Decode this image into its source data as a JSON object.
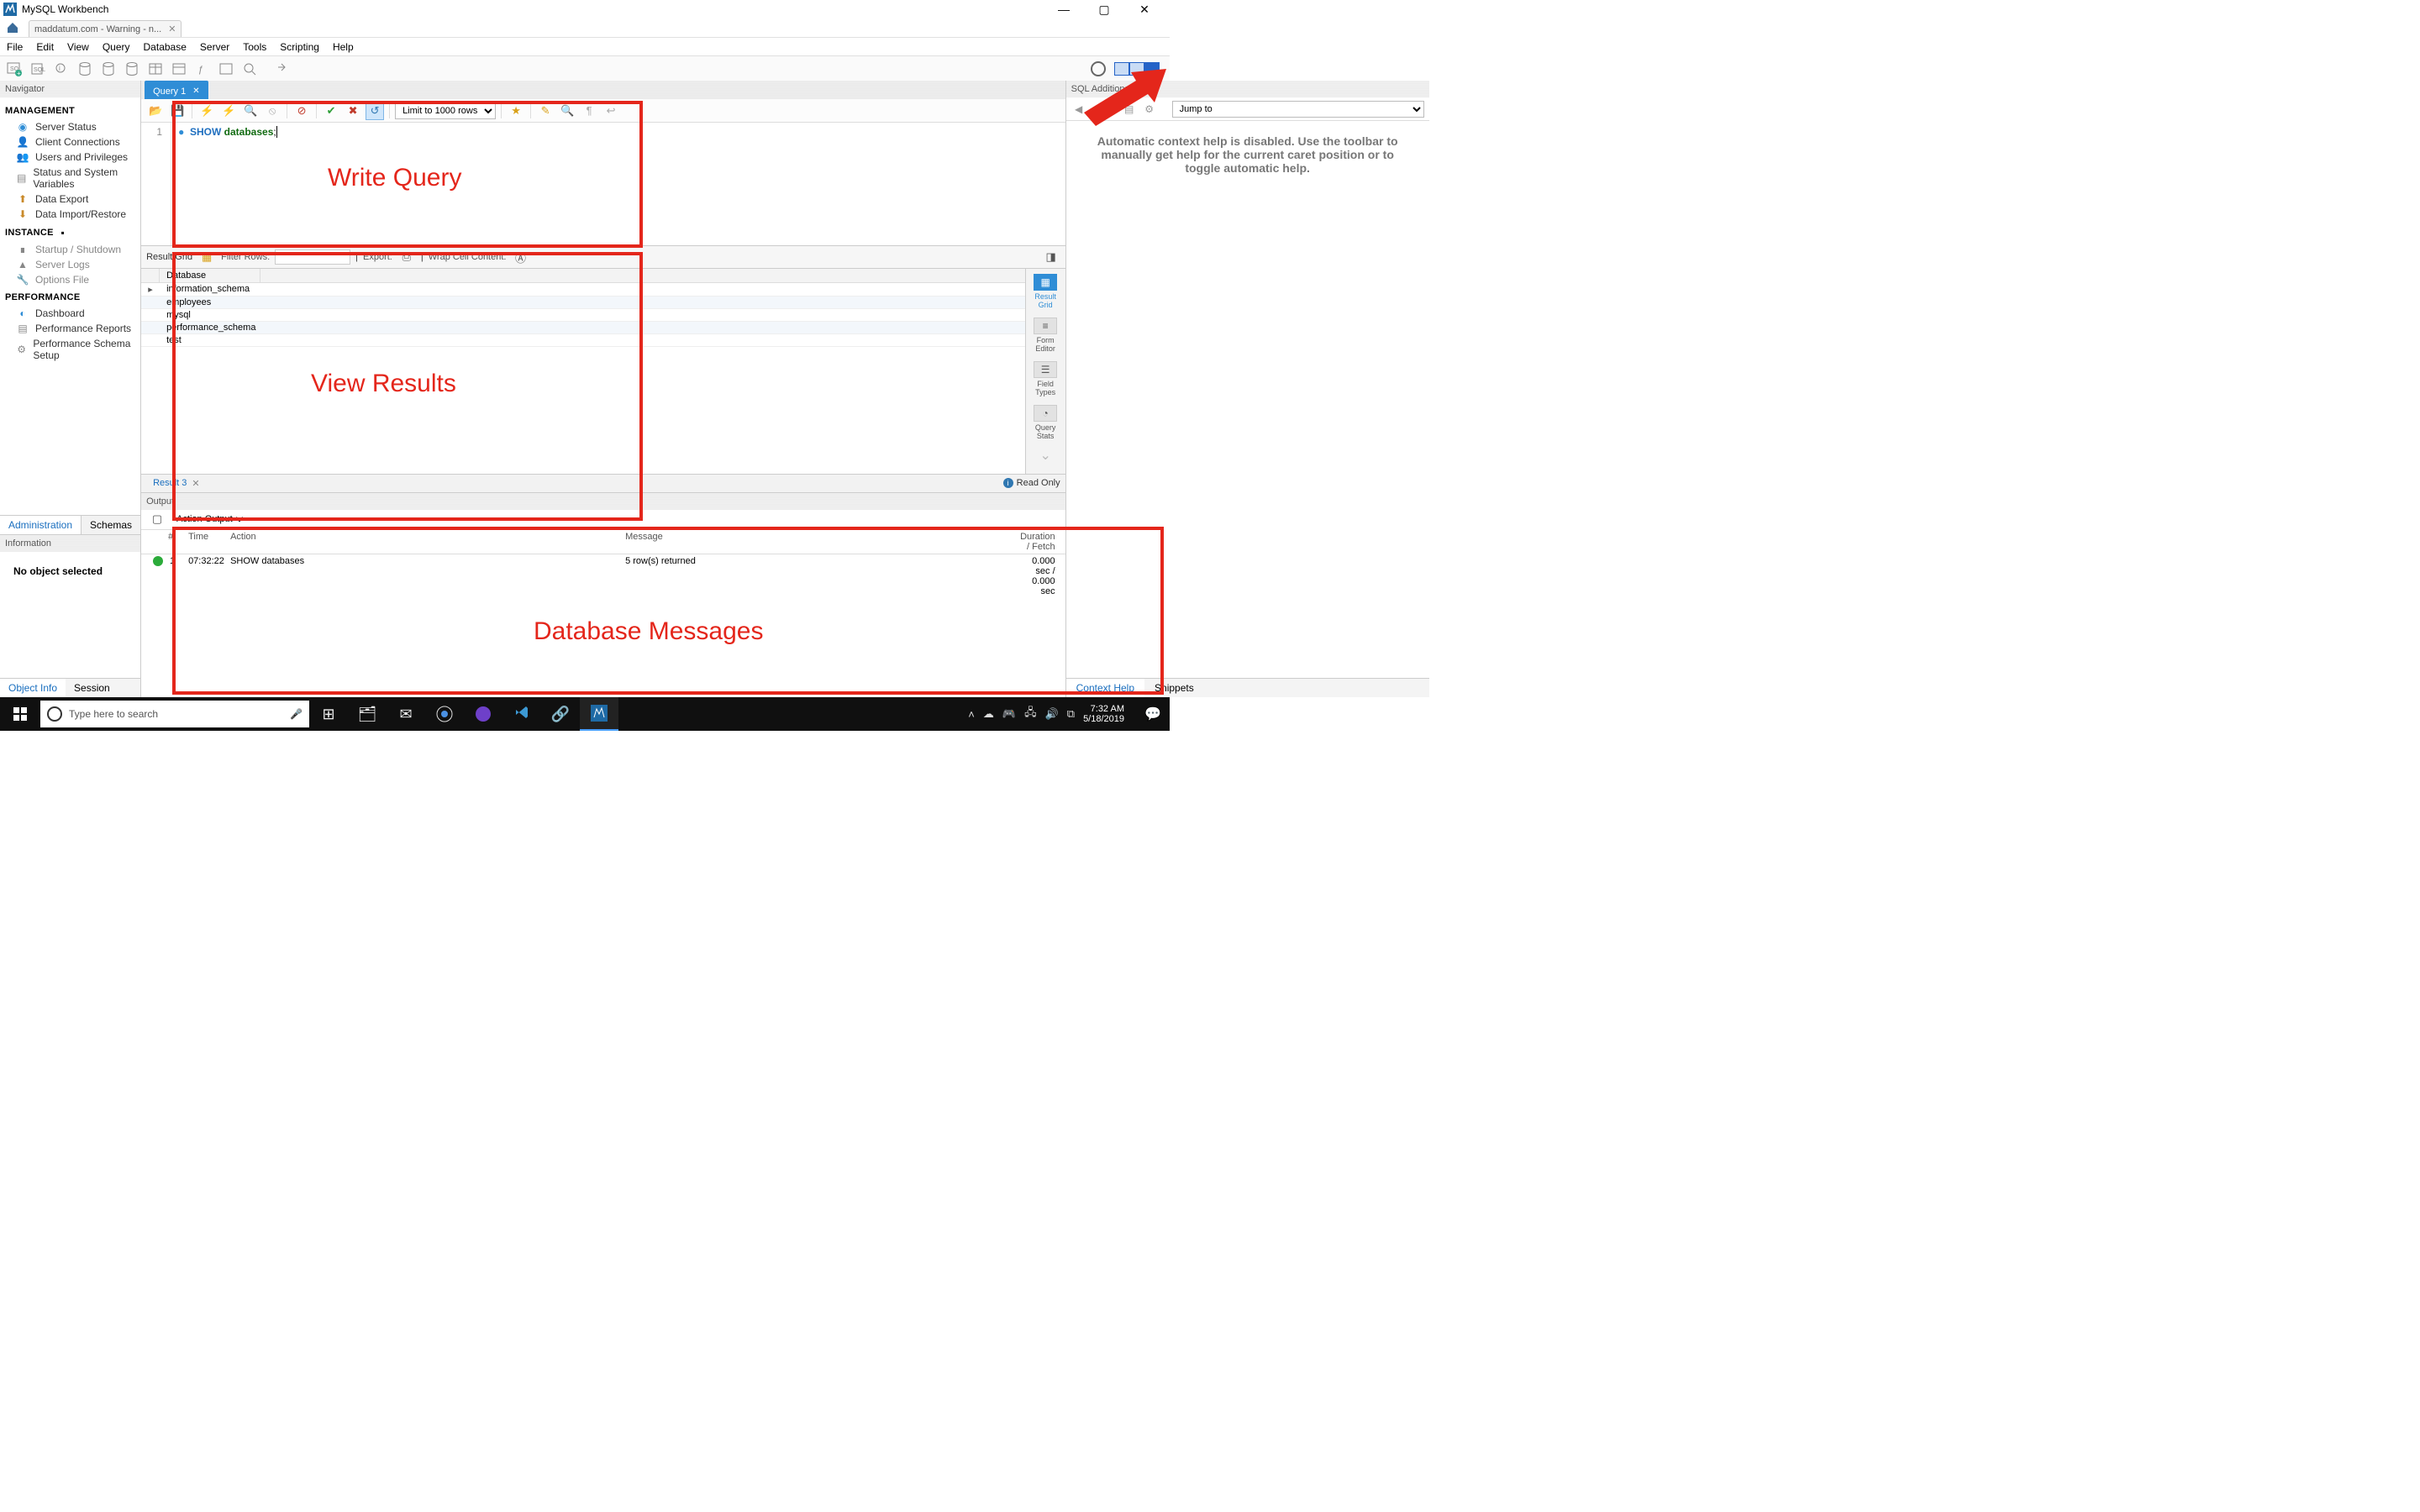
{
  "app": {
    "title": "MySQL Workbench"
  },
  "window": {
    "minimize": "—",
    "maximize": "▢",
    "close": "✕"
  },
  "doc_tab": {
    "label": "maddatum.com - Warning - n..."
  },
  "menu": [
    "File",
    "Edit",
    "View",
    "Query",
    "Database",
    "Server",
    "Tools",
    "Scripting",
    "Help"
  ],
  "navigator": {
    "title": "Navigator",
    "sections": {
      "management": {
        "label": "MANAGEMENT",
        "items": [
          "Server Status",
          "Client Connections",
          "Users and Privileges",
          "Status and System Variables",
          "Data Export",
          "Data Import/Restore"
        ]
      },
      "instance": {
        "label": "INSTANCE",
        "items": [
          "Startup / Shutdown",
          "Server Logs",
          "Options File"
        ]
      },
      "performance": {
        "label": "PERFORMANCE",
        "items": [
          "Dashboard",
          "Performance Reports",
          "Performance Schema Setup"
        ]
      }
    },
    "tabs": {
      "admin": "Administration",
      "schemas": "Schemas"
    }
  },
  "information": {
    "title": "Information",
    "body": "No object selected",
    "tabs": {
      "object": "Object Info",
      "session": "Session"
    }
  },
  "query": {
    "tab_label": "Query 1",
    "limit_label": "Limit to 1000 rows",
    "line": "1",
    "kw": "SHOW",
    "stmt": "databases",
    "term": ";"
  },
  "results": {
    "result_grid_label": "Result Grid",
    "filter_label": "Filter Rows:",
    "export_label": "Export:",
    "wrap_label": "Wrap Cell Content:",
    "column": "Database",
    "rows": [
      "information_schema",
      "employees",
      "mysql",
      "performance_schema",
      "test"
    ],
    "side": {
      "grid": "Result Grid",
      "form": "Form Editor",
      "types": "Field Types",
      "stats": "Query Stats"
    },
    "tab": "Result 3",
    "readonly": "Read Only"
  },
  "sql_additions": {
    "title": "SQL Additions",
    "jump": "Jump to",
    "help_text": "Automatic context help is disabled. Use the toolbar to manually get help for the current caret position or to toggle automatic help.",
    "tabs": {
      "context": "Context Help",
      "snippets": "Snippets"
    }
  },
  "output": {
    "title": "Output",
    "dropdown": "Action Output",
    "cols": {
      "n": "#",
      "time": "Time",
      "action": "Action",
      "message": "Message",
      "duration": "Duration / Fetch"
    },
    "row": {
      "n": "1",
      "time": "07:32:22",
      "action": "SHOW databases",
      "message": "5 row(s) returned",
      "duration": "0.000 sec / 0.000 sec"
    }
  },
  "annotations": {
    "write": "Write Query",
    "view": "View Results",
    "msgs": "Database Messages"
  },
  "taskbar": {
    "search_placeholder": "Type here to search",
    "clock_time": "7:32 AM",
    "clock_date": "5/18/2019"
  }
}
